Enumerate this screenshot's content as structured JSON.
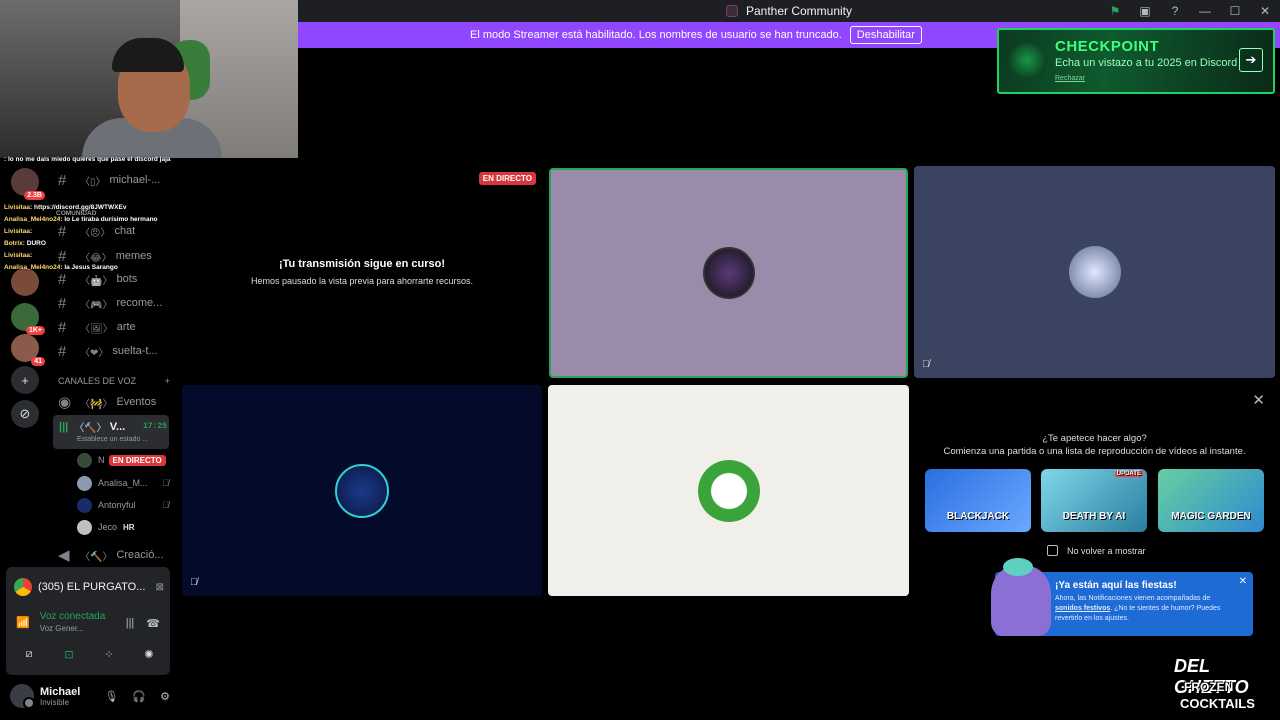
{
  "window": {
    "title": "Panther Community"
  },
  "banner": {
    "message": "El modo Streamer está habilitado. Los nombres de usuario se han truncado.",
    "button": "Deshabilitar"
  },
  "checkpoint": {
    "title": "CHECKPOINT",
    "subtitle": "Echa un vistazo a tu 2025 en Discord",
    "dismiss": "Rechazar",
    "accent": "#1fd15f"
  },
  "chat_overlay": {
    "lines": [
      {
        "user": "",
        "text": ": lo no me dais miedo quieres que pase el discord jaja"
      },
      {
        "user": "Livisitaa",
        "text": ": https://discord.gg/8JWTWXEv"
      },
      {
        "user": "Analisa_Mel4no24",
        "text": ": lo Le tiraba durísimo hermano"
      },
      {
        "user": "Livisitaa",
        "text": ":"
      },
      {
        "user": "Botrix",
        "text": ": DURO"
      },
      {
        "user": "Livisitaa",
        "text": ":"
      },
      {
        "user": "Analisa_Mel4no24",
        "text": ": la Jesus Sarango"
      }
    ],
    "comunidad": "COMUNIDAD"
  },
  "servers": [
    {
      "badge": "2.3B"
    },
    {
      "badge": ""
    },
    {
      "badge": "1K+"
    },
    {
      "badge": "41"
    },
    {
      "badge": ""
    },
    {
      "badge": ""
    }
  ],
  "channels": {
    "text": [
      {
        "name": "michael-..."
      },
      {
        "name": "chat"
      },
      {
        "name": "memes"
      },
      {
        "name": "bots"
      },
      {
        "name": "recome..."
      },
      {
        "name": "arte"
      },
      {
        "name": "suelta-t..."
      }
    ],
    "voice_category": "CANALES DE VOZ",
    "voice_events": "Eventos",
    "active_voice": {
      "name": "V...",
      "time": "17:25",
      "status": "Establece un estado ..."
    },
    "voice_users": [
      {
        "name": "N",
        "live": "EN DIRECTO"
      },
      {
        "name": "Analisa_M...",
        "live": ""
      },
      {
        "name": "Antonyful",
        "live": ""
      },
      {
        "name": "Jeco",
        "live": "HR"
      }
    ],
    "creation": "Creació..."
  },
  "voice_panel": {
    "server": "(305) EL PURGATO...",
    "connected": "Voz conectada",
    "channel": "Voz Gener..."
  },
  "user": {
    "name": "Michael",
    "status": "Invisible"
  },
  "stage": {
    "live_label": "EN DIRECTO",
    "paused_title": "¡Tu transmisión sigue en curso!",
    "paused_sub": "Hemos pausado la vista previa para ahorrarte recursos.",
    "tile_colors": [
      "#9a8bab",
      "#3a4360",
      "#040a2a",
      "#f1efe9"
    ]
  },
  "activity": {
    "q1": "¿Te apetece hacer algo?",
    "q2": "Comienza una partida o una lista de reproducción de vídeos al instante.",
    "games": [
      {
        "name": "BLACKJACK",
        "badge": ""
      },
      {
        "name": "DEATH BY AI",
        "badge": "UPDATE"
      },
      {
        "name": "MAGIC GARDEN",
        "badge": ""
      }
    ],
    "no_more": "No volver a mostrar"
  },
  "toast": {
    "title": "¡Ya están aquí las fiestas!",
    "body1": "Ahora, las Notificaciones vienen acompañadas de",
    "body_link": "sonidos festivos",
    "body2": ". ¿No te sientes de humor? Puedes revertirlo en los ajustes."
  },
  "watermark": {
    "l1": "DEL GHETTO",
    "l2": "FROZEN",
    "l3": "COCKTAILS"
  }
}
